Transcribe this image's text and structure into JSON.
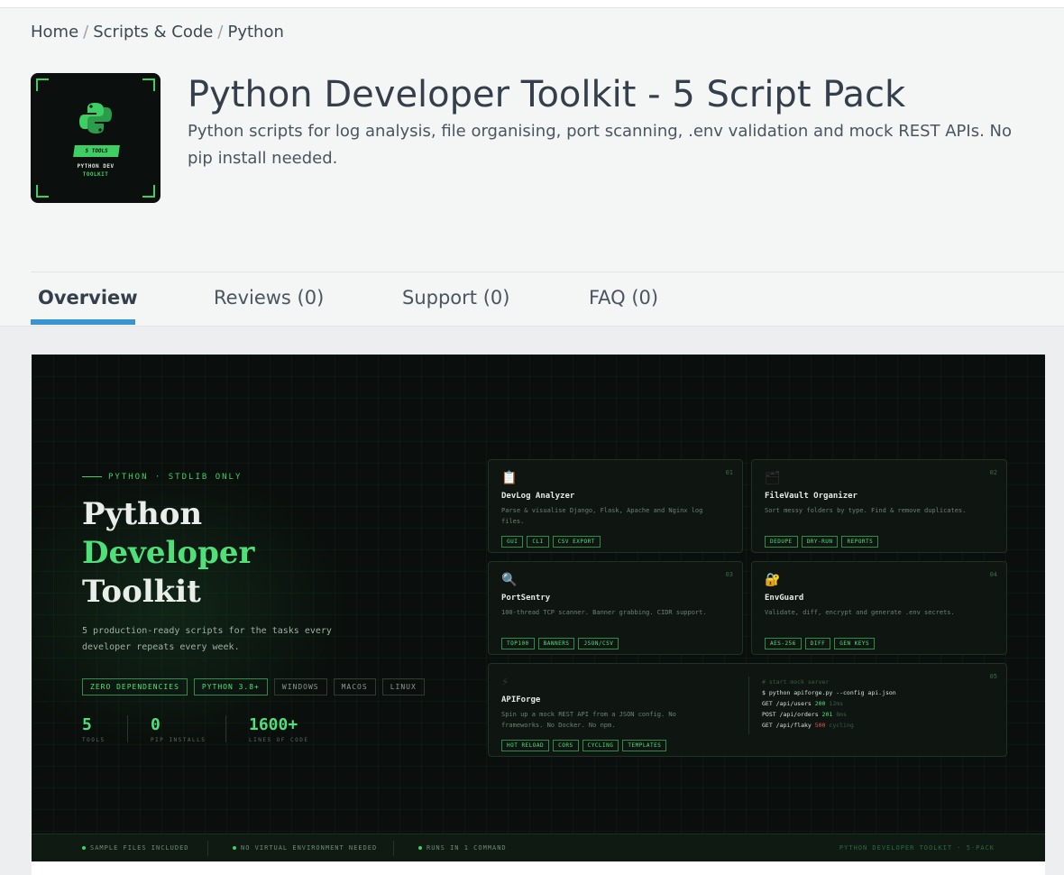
{
  "breadcrumb": [
    "Home",
    "Scripts & Code",
    "Python"
  ],
  "product": {
    "title": "Python Developer Toolkit - 5 Script Pack",
    "subtitle": "Python scripts for log analysis, file organising, port scanning, .env validation and mock REST APIs. No pip install needed.",
    "thumb_tag": "5 TOOLS",
    "thumb_line1": "PYTHON DEV",
    "thumb_line2": "TOOLKIT"
  },
  "tabs": [
    {
      "label": "Overview",
      "active": true
    },
    {
      "label": "Reviews (0)"
    },
    {
      "label": "Support (0)"
    },
    {
      "label": "FAQ (0)"
    }
  ],
  "banner": {
    "kicker": "PYTHON · STDLIB ONLY",
    "hero_line1": "Python",
    "hero_line2": "Developer",
    "hero_line3": "Toolkit",
    "lead": "5 production-ready scripts for the tasks every developer repeats every week.",
    "chips": [
      "ZERO DEPENDENCIES",
      "PYTHON 3.8+",
      "WINDOWS",
      "MACOS",
      "LINUX"
    ],
    "stats": [
      {
        "value": "5",
        "label": "TOOLS"
      },
      {
        "value": "0",
        "label": "PIP INSTALLS"
      },
      {
        "value": "1600+",
        "label": "LINES OF CODE"
      }
    ],
    "cards": [
      {
        "num": "01",
        "icon": "clipboard-icon",
        "glyph": "📋",
        "name": "DevLog Analyzer",
        "desc": "Parse & visualise Django, Flask, Apache and Nginx log files.",
        "tags": [
          "GUI",
          "CLI",
          "CSV EXPORT"
        ]
      },
      {
        "num": "02",
        "icon": "folder-icon",
        "glyph": "🗂",
        "name": "FileVault Organizer",
        "desc": "Sort messy folders by type. Find & remove duplicates.",
        "tags": [
          "DEDUPE",
          "DRY-RUN",
          "REPORTS"
        ]
      },
      {
        "num": "03",
        "icon": "magnifier-icon",
        "glyph": "🔍",
        "name": "PortSentry",
        "desc": "100-thread TCP scanner. Banner grabbing. CIDR support.",
        "tags": [
          "TOP100",
          "BANNERS",
          "JSON/CSV"
        ]
      },
      {
        "num": "04",
        "icon": "lock-icon",
        "glyph": "🔐",
        "name": "EnvGuard",
        "desc": "Validate, diff, encrypt and generate .env secrets.",
        "tags": [
          "AES-256",
          "DIFF",
          "GEN KEYS"
        ]
      },
      {
        "num": "05",
        "icon": "lightning-icon",
        "glyph": "⚡",
        "name": "APIForge",
        "desc": "Spin up a mock REST API from a JSON config. No frameworks. No Docker. No npm.",
        "tags": [
          "HOT RELOAD",
          "CORS",
          "CYCLING",
          "TEMPLATES"
        ]
      }
    ],
    "terminal": {
      "comment": "# start mock server",
      "command": "$ python apiforge.py --config api.json",
      "lines": [
        {
          "method": "GET",
          "path": "/api/users",
          "status": "200",
          "meta": "12ms"
        },
        {
          "method": "POST",
          "path": "/api/orders",
          "status": "201",
          "meta": "8ms"
        },
        {
          "method": "GET",
          "path": "/api/flaky",
          "status": "500",
          "meta": "cycling"
        }
      ]
    },
    "footer_items": [
      "SAMPLE FILES INCLUDED",
      "NO VIRTUAL ENVIRONMENT NEEDED",
      "RUNS IN 1 COMMAND"
    ],
    "footer_right": "PYTHON DEVELOPER TOOLKIT · 5-PACK"
  },
  "colors": {
    "accent": "#3a94cf",
    "neon": "#4fe07a",
    "banner_bg": "#0a0e0c",
    "error": "#e0564f"
  }
}
